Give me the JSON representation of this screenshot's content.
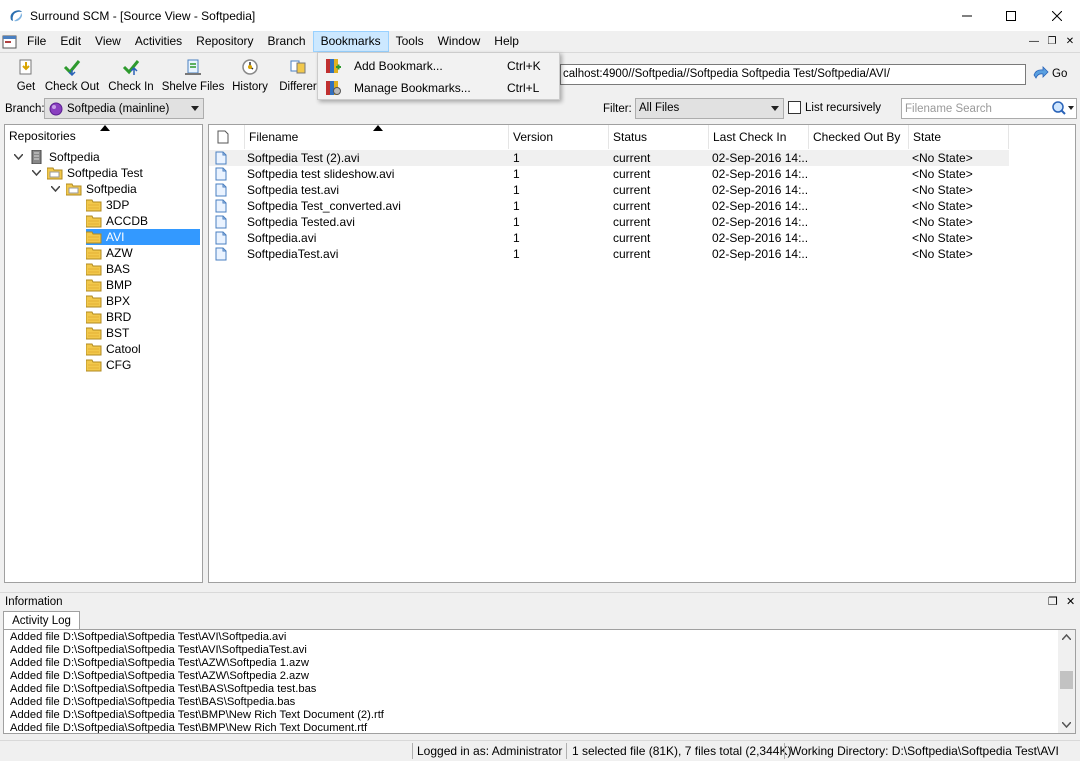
{
  "window": {
    "title": "Surround SCM - [Source View - Softpedia]"
  },
  "menu": {
    "items": [
      "File",
      "Edit",
      "View",
      "Activities",
      "Repository",
      "Branch",
      "Bookmarks",
      "Tools",
      "Window",
      "Help"
    ],
    "open_menu": "Bookmarks"
  },
  "bookmarks_menu": {
    "items": [
      {
        "label": "Add Bookmark...",
        "shortcut": "Ctrl+K",
        "icon": "add-bookmark-icon"
      },
      {
        "label": "Manage Bookmarks...",
        "shortcut": "Ctrl+L",
        "icon": "manage-bookmarks-icon"
      }
    ]
  },
  "toolbar": {
    "buttons": [
      {
        "label": "Get",
        "icon": "get-icon"
      },
      {
        "label": "Check Out",
        "icon": "check-out-icon"
      },
      {
        "label": "Check In",
        "icon": "check-in-icon"
      },
      {
        "label": "Shelve Files",
        "icon": "shelve-files-icon"
      },
      {
        "label": "History",
        "icon": "history-icon"
      },
      {
        "label": "Differer",
        "icon": "differences-icon"
      }
    ],
    "address": "calhost:4900//Softpedia//Softpedia Softpedia Test/Softpedia/AVI/",
    "go_label": "Go"
  },
  "branch_row": {
    "branch_label": "Branch:",
    "branch_value": "Softpedia (mainline)",
    "filter_label": "Filter:",
    "filter_value": "All Files",
    "list_recursively": "List recursively",
    "search_placeholder": "Filename Search"
  },
  "repositories": {
    "header": "Repositories",
    "nodes": [
      {
        "label": "Softpedia",
        "level": 0,
        "type": "server",
        "expanded": true
      },
      {
        "label": "Softpedia Test",
        "level": 1,
        "type": "folder-open",
        "expanded": true
      },
      {
        "label": "Softpedia",
        "level": 2,
        "type": "folder-open",
        "expanded": true
      },
      {
        "label": "3DP",
        "level": 3,
        "type": "folder"
      },
      {
        "label": "ACCDB",
        "level": 3,
        "type": "folder"
      },
      {
        "label": "AVI",
        "level": 3,
        "type": "folder",
        "selected": true
      },
      {
        "label": "AZW",
        "level": 3,
        "type": "folder"
      },
      {
        "label": "BAS",
        "level": 3,
        "type": "folder"
      },
      {
        "label": "BMP",
        "level": 3,
        "type": "folder"
      },
      {
        "label": "BPX",
        "level": 3,
        "type": "folder"
      },
      {
        "label": "BRD",
        "level": 3,
        "type": "folder"
      },
      {
        "label": "BST",
        "level": 3,
        "type": "folder"
      },
      {
        "label": "Catool",
        "level": 3,
        "type": "folder"
      },
      {
        "label": "CFG",
        "level": 3,
        "type": "folder"
      }
    ]
  },
  "files": {
    "columns": [
      "Filename",
      "Version",
      "Status",
      "Last Check In",
      "Checked Out By",
      "State"
    ],
    "rows": [
      {
        "name": "Softpedia Test (2).avi",
        "version": "1",
        "status": "current",
        "last_check_in": "02-Sep-2016 14:...",
        "checked_out_by": "",
        "state": "<No State>"
      },
      {
        "name": "Softpedia test slideshow.avi",
        "version": "1",
        "status": "current",
        "last_check_in": "02-Sep-2016 14:...",
        "checked_out_by": "",
        "state": "<No State>"
      },
      {
        "name": "Softpedia test.avi",
        "version": "1",
        "status": "current",
        "last_check_in": "02-Sep-2016 14:...",
        "checked_out_by": "",
        "state": "<No State>"
      },
      {
        "name": "Softpedia Test_converted.avi",
        "version": "1",
        "status": "current",
        "last_check_in": "02-Sep-2016 14:...",
        "checked_out_by": "",
        "state": "<No State>"
      },
      {
        "name": "Softpedia Tested.avi",
        "version": "1",
        "status": "current",
        "last_check_in": "02-Sep-2016 14:...",
        "checked_out_by": "",
        "state": "<No State>"
      },
      {
        "name": "Softpedia.avi",
        "version": "1",
        "status": "current",
        "last_check_in": "02-Sep-2016 14:...",
        "checked_out_by": "",
        "state": "<No State>"
      },
      {
        "name": "SoftpediaTest.avi",
        "version": "1",
        "status": "current",
        "last_check_in": "02-Sep-2016 14:...",
        "checked_out_by": "",
        "state": "<No State>"
      }
    ]
  },
  "information": {
    "title": "Information",
    "tab": "Activity Log",
    "log": [
      "Added file D:\\Softpedia\\Softpedia Test\\AVI\\Softpedia.avi",
      "Added file D:\\Softpedia\\Softpedia Test\\AVI\\SoftpediaTest.avi",
      "Added file D:\\Softpedia\\Softpedia Test\\AZW\\Softpedia 1.azw",
      "Added file D:\\Softpedia\\Softpedia Test\\AZW\\Softpedia 2.azw",
      "Added file D:\\Softpedia\\Softpedia Test\\BAS\\Softpedia test.bas",
      "Added file D:\\Softpedia\\Softpedia Test\\BAS\\Softpedia.bas",
      "Added file D:\\Softpedia\\Softpedia Test\\BMP\\New Rich Text Document (2).rtf",
      "Added file D:\\Softpedia\\Softpedia Test\\BMP\\New Rich Text Document.rtf"
    ]
  },
  "status_bar": {
    "logged_in": "Logged in as: Administrator",
    "selection": "1 selected file (81K), 7 files total (2,344K)",
    "working_dir": "Working Directory: D:\\Softpedia\\Softpedia Test\\AVI"
  },
  "colors": {
    "selection": "#3399ff",
    "menu_highlight": "#cce8ff",
    "folder": "#f2c84b"
  }
}
